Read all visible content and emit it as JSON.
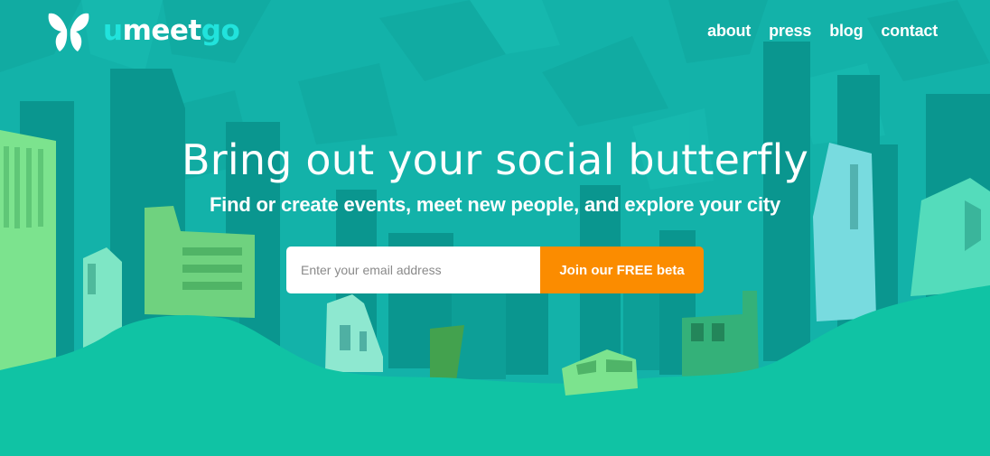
{
  "brand": {
    "logo_prefix": "u",
    "logo_middle": "meet",
    "logo_suffix": "go",
    "logo_icon": "butterfly-icon",
    "accent_color": "#21e3dc"
  },
  "nav": {
    "items": [
      {
        "label": "about"
      },
      {
        "label": "press"
      },
      {
        "label": "blog"
      },
      {
        "label": "contact"
      }
    ]
  },
  "hero": {
    "title": "Bring out your social butterfly",
    "subtitle": "Find or create events, meet new people, and explore your city"
  },
  "signup": {
    "email_placeholder": "Enter your email address",
    "email_value": "",
    "button_label": "Join our FREE beta",
    "button_color": "#fb8c00"
  },
  "colors": {
    "background": "#13b2a9",
    "ground": "#10c3a4"
  }
}
